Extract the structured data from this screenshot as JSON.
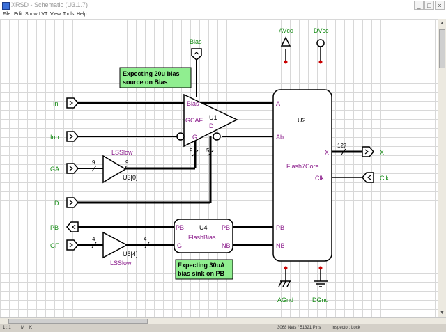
{
  "window": {
    "title": "XRSD - Schematic (U3.1.7)",
    "buttons": [
      "_",
      "□",
      "×"
    ]
  },
  "menu": [
    "File",
    "Edit",
    "Show",
    "LVT",
    "View",
    "Tools",
    "Help"
  ],
  "ports_left": {
    "in": "In",
    "inb": "Inb",
    "ga": "GA",
    "d": "D",
    "pb": "PB",
    "gf": "GF"
  },
  "ports_right": {
    "x": "X",
    "clk": "Clk"
  },
  "top": {
    "bias": "Bias",
    "avcc": "AVcc",
    "dvcc": "DVcc"
  },
  "bottom": {
    "agnd": "AGnd",
    "dgnd": "DGnd"
  },
  "notes": {
    "bias_source": [
      "Expecting 20u bias",
      "source on Bias"
    ],
    "bias_sink": [
      "Expecting 30uA",
      "bias sink on PB"
    ]
  },
  "u1": {
    "name": "U1",
    "type": "GCAF",
    "pin_bias": "Bias",
    "pin_g": "G",
    "pin_d": "D"
  },
  "u2": {
    "name": "U2",
    "type": "Flash7Core",
    "pin_a": "A",
    "pin_ab": "Ab",
    "pin_pb": "PB",
    "pin_nb": "NB",
    "pin_x": "X",
    "pin_clk": "Clk"
  },
  "u3": {
    "name": "U3[0]",
    "type": "LSSlow"
  },
  "u4": {
    "name": "U4",
    "type": "FlashBias",
    "pin_pb_l": "PB",
    "pin_g": "G",
    "pin_pb_r": "PB",
    "pin_nb": "NB"
  },
  "u5": {
    "name": "U5[4]",
    "type": "LSSlow"
  },
  "bus": {
    "ga_in": "9",
    "u3_out": "9",
    "g_bus": "9",
    "d_bus": "5",
    "x_bus": "127",
    "gf_in": "4",
    "u5_out": "4"
  },
  "status": [
    "1 : 1",
    "M",
    "K",
    "3068 Nets / 51321 Pins",
    "Inspector: Lock"
  ],
  "colors": {
    "green": "#138a13",
    "purple": "#8a1a8a",
    "note_bg": "#90ee90",
    "red_dot": "#cc0000"
  }
}
